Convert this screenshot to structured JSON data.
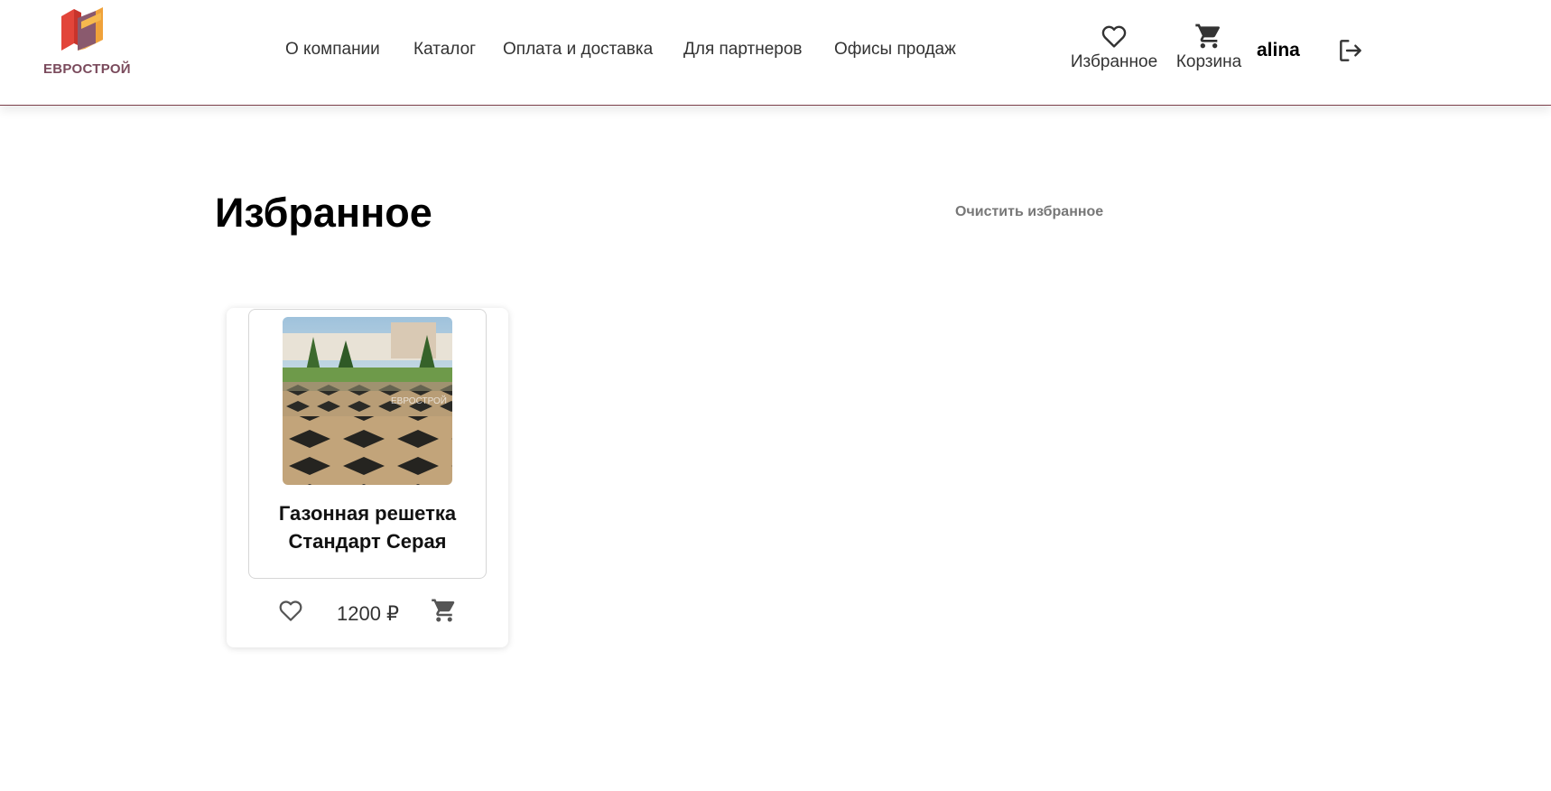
{
  "brand": {
    "name": "ЕВРОСТРОЙ",
    "superscript": "",
    "tagline": "",
    "colors": {
      "orange": "#f0a23a",
      "red": "#e2453a",
      "mauve": "#8a5a6e",
      "text": "#7a4a5c"
    }
  },
  "nav": {
    "items": [
      {
        "label": "О компании"
      },
      {
        "label": "Каталог"
      },
      {
        "label": "Оплата и доставка"
      },
      {
        "label": "Для партнеров"
      },
      {
        "label": "Офисы продаж"
      }
    ]
  },
  "header_actions": {
    "favorites_label": "Избранное",
    "favorites_icon": "heart-outline-icon",
    "cart_label": "Корзина",
    "cart_icon": "shopping-cart-icon",
    "username": "alina",
    "logout_icon": "logout-icon"
  },
  "page": {
    "title": "Избранное",
    "clear_label": "Очистить избранное"
  },
  "favorites": [
    {
      "name": "Газонная решетка Стандарт Серая",
      "price": "1200 ₽",
      "watermark": "ЕВРОСТРОЙ"
    }
  ],
  "colors": {
    "header_border": "#7b3f4a",
    "muted_text": "#777777",
    "icon": "#555555"
  }
}
